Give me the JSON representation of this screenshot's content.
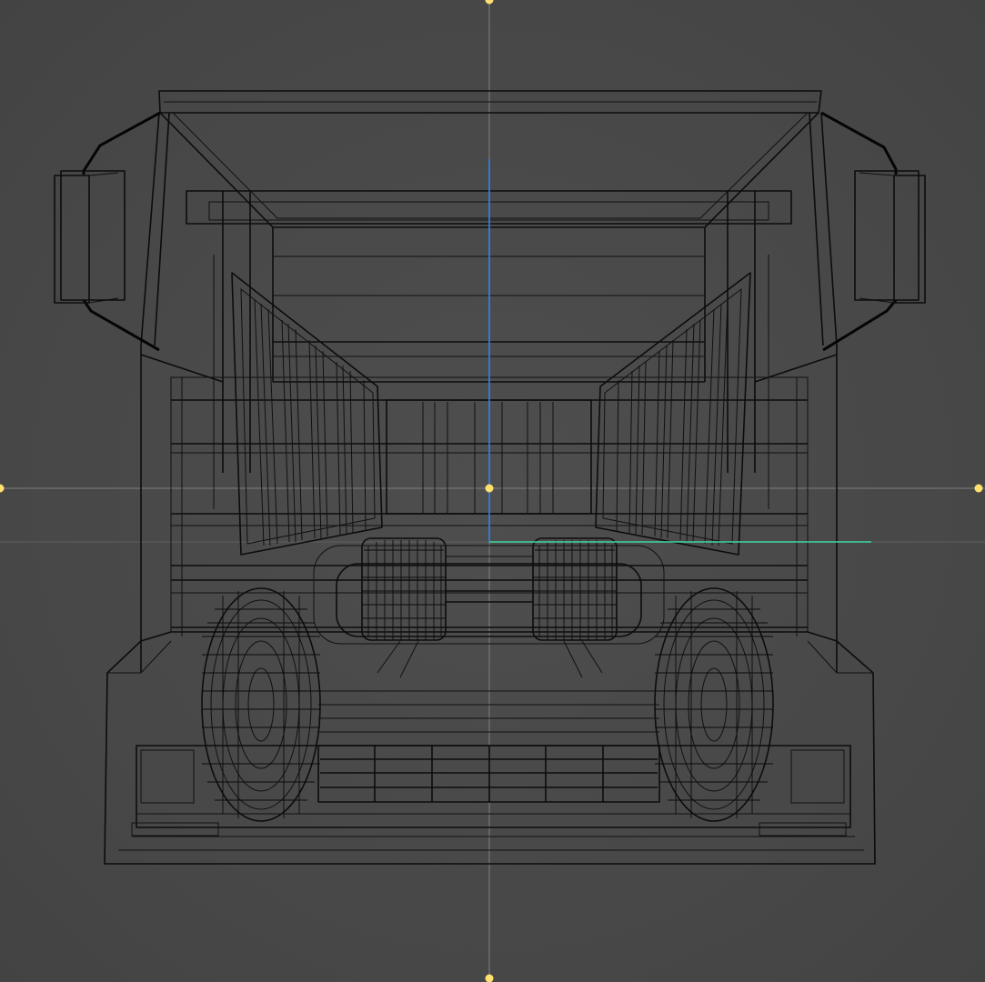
{
  "viewport": {
    "background": "#4a4a4a",
    "wire_color": "#0c0c0c",
    "guide_color": "#8a8a8a",
    "handle_color": "#ffe070",
    "axis_z_color": "#2f86e8",
    "axis_x_color": "#3fd7a0",
    "model": "dump-truck-wireframe-front-view",
    "icons": [
      "move-handle-icon",
      "axis-gizmo-icon"
    ]
  }
}
